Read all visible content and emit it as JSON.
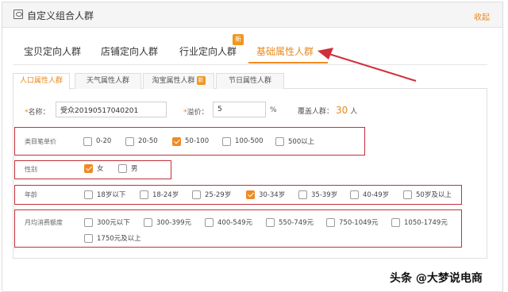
{
  "header": {
    "title": "自定义组合人群",
    "collapse_label": "收起"
  },
  "main_tabs": [
    {
      "label": "宝贝定向人群"
    },
    {
      "label": "店铺定向人群"
    },
    {
      "label": "行业定向人群",
      "badge": "新"
    },
    {
      "label": "基础属性人群",
      "active": true
    }
  ],
  "sub_tabs": [
    {
      "label": "人口属性人群",
      "active": true
    },
    {
      "label": "天气属性人群"
    },
    {
      "label": "淘宝属性人群",
      "badge": "新"
    },
    {
      "label": "节日属性人群"
    }
  ],
  "form": {
    "name_label": "名称：",
    "name_required": "*",
    "name_value": "受众20190517040201",
    "bid_label": "溢价：",
    "bid_required": "*",
    "bid_value": "5",
    "bid_unit": "%",
    "coverage_label": "覆盖人群：",
    "coverage_value": "30",
    "coverage_unit": "人"
  },
  "rows": {
    "category_price": {
      "label": "类目笔单价",
      "options": [
        {
          "label": "0-20",
          "checked": false
        },
        {
          "label": "20-50",
          "checked": false
        },
        {
          "label": "50-100",
          "checked": true
        },
        {
          "label": "100-500",
          "checked": false
        },
        {
          "label": "500以上",
          "checked": false
        }
      ]
    },
    "gender": {
      "label": "性别",
      "options": [
        {
          "label": "女",
          "checked": true
        },
        {
          "label": "男",
          "checked": false
        }
      ]
    },
    "age": {
      "label": "年龄",
      "options": [
        {
          "label": "18岁以下",
          "checked": false
        },
        {
          "label": "18-24岁",
          "checked": false
        },
        {
          "label": "25-29岁",
          "checked": false
        },
        {
          "label": "30-34岁",
          "checked": true
        },
        {
          "label": "35-39岁",
          "checked": false
        },
        {
          "label": "40-49岁",
          "checked": false
        },
        {
          "label": "50岁及以上",
          "checked": false
        }
      ]
    },
    "monthly_spend": {
      "label": "月均消费额度",
      "options": [
        {
          "label": "300元以下",
          "checked": false
        },
        {
          "label": "300-399元",
          "checked": false
        },
        {
          "label": "400-549元",
          "checked": false
        },
        {
          "label": "550-749元",
          "checked": false
        },
        {
          "label": "750-1049元",
          "checked": false
        },
        {
          "label": "1050-1749元",
          "checked": false
        },
        {
          "label": "1750元及以上",
          "checked": false
        }
      ]
    }
  },
  "watermark": "头条 @大梦说电商",
  "colors": {
    "accent": "#f08a24",
    "highlight_box": "#c2303a",
    "arrow": "#d0303a"
  }
}
